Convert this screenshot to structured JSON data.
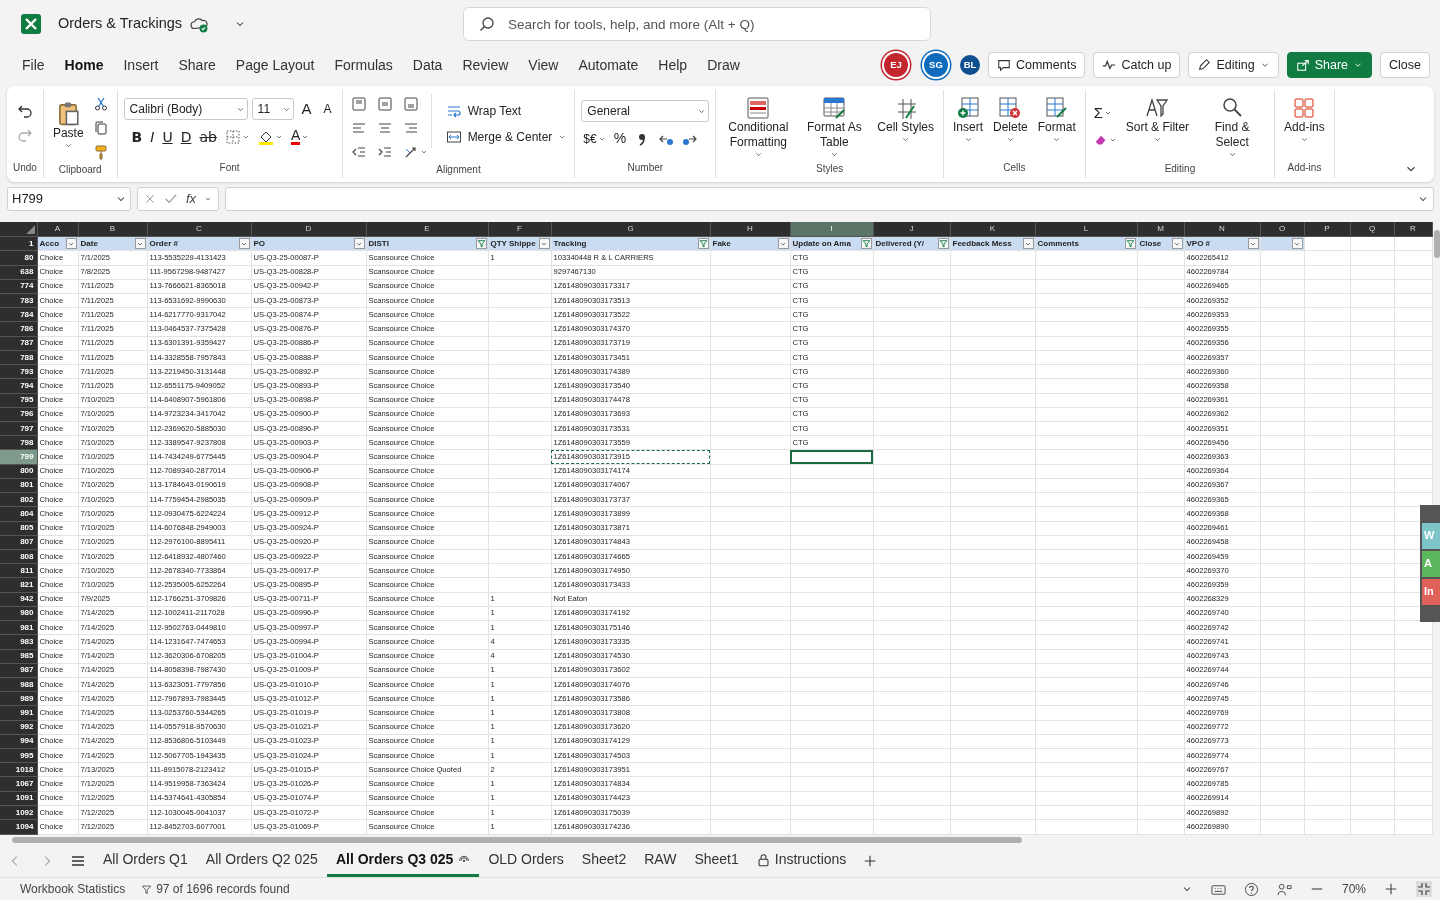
{
  "title_bar": {
    "file_name": "Orders & Trackings",
    "search": {
      "placeholder": "Search for tools, help, and more (Alt + Q)"
    }
  },
  "menu": [
    {
      "text": "File",
      "selected": false
    },
    {
      "text": "Home",
      "selected": true
    },
    {
      "text": "Insert",
      "selected": false
    },
    {
      "text": "Share",
      "selected": false
    },
    {
      "text": "Page Layout",
      "selected": false
    },
    {
      "text": "Formulas",
      "selected": false
    },
    {
      "text": "Data",
      "selected": false
    },
    {
      "text": "Review",
      "selected": false
    },
    {
      "text": "View",
      "selected": false
    },
    {
      "text": "Automate",
      "selected": false
    },
    {
      "text": "Help",
      "selected": false
    },
    {
      "text": "Draw",
      "selected": false
    }
  ],
  "avatars": [
    {
      "initials": "EJ",
      "color": "#c4262e",
      "ring": true
    },
    {
      "initials": "SG",
      "color": "#0f6cbd",
      "ring": true
    },
    {
      "initials": "BL",
      "color": "#0e4f8f",
      "ring": false
    }
  ],
  "actions": [
    {
      "text": "Comments",
      "kind": "comments"
    },
    {
      "text": "Catch up",
      "kind": "catchup"
    },
    {
      "text": "Editing",
      "kind": "editing"
    },
    {
      "text": "Share",
      "kind": "share"
    },
    {
      "text": "Close",
      "kind": "close"
    }
  ],
  "ribbon": [
    {
      "kind": "undo",
      "label": "Undo"
    },
    {
      "kind": "clipboard",
      "label": "Clipboard",
      "paste": "Paste"
    },
    {
      "kind": "font",
      "label": "Font",
      "font_name": "Calibri (Body)",
      "font_size": "11",
      "size_buttons": [
        {
          "text": "A",
          "kind": "grow"
        },
        {
          "text": "A",
          "kind": "shrink"
        }
      ],
      "style_buttons": [
        {
          "text": "B",
          "kind": "bold"
        },
        {
          "text": "I",
          "kind": "italic"
        },
        {
          "text": "U",
          "kind": "underline"
        },
        {
          "text": "D",
          "kind": "double"
        },
        {
          "text": "ab",
          "kind": "strike"
        }
      ],
      "font_color": "A"
    },
    {
      "kind": "alignment",
      "label": "Alignment",
      "wrap": "Wrap Text",
      "merge": "Merge & Center"
    },
    {
      "kind": "number",
      "label": "Number",
      "format": "General",
      "currency": "$€",
      "percent": "%"
    },
    {
      "kind": "styles",
      "label": "Styles",
      "buttons": [
        {
          "text": "Conditional Formatting"
        },
        {
          "text": "Format As Table"
        },
        {
          "text": "Cell Styles"
        }
      ]
    },
    {
      "kind": "cells",
      "label": "Cells",
      "buttons": [
        {
          "text": "Insert"
        },
        {
          "text": "Delete"
        },
        {
          "text": "Format"
        }
      ]
    },
    {
      "kind": "editing",
      "label": "Editing",
      "sum": "Σ",
      "buttons": [
        {
          "text": "Sort & Filter"
        },
        {
          "text": "Find & Select"
        }
      ]
    },
    {
      "kind": "addins",
      "label": "Add-ins",
      "buttons": [
        {
          "text": "Add-ins"
        }
      ]
    }
  ],
  "formula_bar": {
    "name_box": "H799",
    "function_label": "fx"
  },
  "sheet": {
    "header_row": "1",
    "columns": [
      {
        "letter": "A",
        "header": "Acco",
        "filter_active": false,
        "selected": false,
        "marquee": false
      },
      {
        "letter": "B",
        "header": "Date",
        "filter_active": false,
        "selected": false,
        "marquee": false
      },
      {
        "letter": "C",
        "header": "Order #",
        "filter_active": false,
        "selected": false,
        "marquee": false
      },
      {
        "letter": "D",
        "header": "PO",
        "filter_active": false,
        "selected": false,
        "marquee": false
      },
      {
        "letter": "E",
        "header": "DISTI",
        "filter_active": true,
        "selected": false,
        "marquee": false
      },
      {
        "letter": "F",
        "header": "QTY Shippe",
        "filter_active": false,
        "selected": false,
        "marquee": false
      },
      {
        "letter": "G",
        "header": "Tracking",
        "filter_active": true,
        "selected": false,
        "marquee": true
      },
      {
        "letter": "H",
        "header": "Fake",
        "filter_active": false,
        "selected": false,
        "marquee": false
      },
      {
        "letter": "I",
        "header": "Update on Ama",
        "filter_active": true,
        "selected": true,
        "marquee": false
      },
      {
        "letter": "J",
        "header": "Delivered (Y/",
        "filter_active": true,
        "selected": false,
        "marquee": false
      },
      {
        "letter": "K",
        "header": "Feedback Mess",
        "filter_active": false,
        "selected": false,
        "marquee": false
      },
      {
        "letter": "L",
        "header": "Comments",
        "filter_active": true,
        "selected": false,
        "marquee": false
      },
      {
        "letter": "M",
        "header": "Close",
        "filter_active": false,
        "selected": false,
        "marquee": false
      },
      {
        "letter": "N",
        "header": "VPO #",
        "filter_active": false,
        "selected": false,
        "marquee": false
      },
      {
        "letter": "O",
        "filter_active": false,
        "selected": false,
        "marquee": false
      },
      {
        "letter": "P",
        "selected": false,
        "marquee": false
      },
      {
        "letter": "Q",
        "selected": false,
        "marquee": false
      },
      {
        "letter": "R",
        "selected": false,
        "marquee": false
      }
    ],
    "rows": [
      {
        "row": "80",
        "selected": false,
        "A": "Choice",
        "B": "7/1/2025",
        "C": "113-5535229-4131423",
        "D": "US-Q3-25-00087-P",
        "E": "Scansource Choice",
        "F": "1",
        "G": "103340448 R & L CARRIERS",
        "I": "CTG",
        "N": "4602265412"
      },
      {
        "row": "638",
        "selected": false,
        "A": "Choice",
        "B": "7/8/2025",
        "C": "111-9567298-9487427",
        "D": "US-Q3-25-00828-P",
        "E": "Scansource Choice",
        "G": "9297467130",
        "I": "CTG",
        "N": "4602269784"
      },
      {
        "row": "774",
        "selected": false,
        "A": "Choice",
        "B": "7/11/2025",
        "C": "113-7666621-8365018",
        "D": "US-Q3-25-00942-P",
        "E": "Scansource Choice",
        "G": "1Z6148090303173317",
        "I": "CTG",
        "N": "4602269465"
      },
      {
        "row": "783",
        "selected": false,
        "A": "Choice",
        "B": "7/11/2025",
        "C": "113-6531692-9990630",
        "D": "US-Q3-25-00873-P",
        "E": "Scansource Choice",
        "G": "1Z6148090303173513",
        "I": "CTG",
        "N": "4602269352"
      },
      {
        "row": "784",
        "selected": false,
        "A": "Choice",
        "B": "7/11/2025",
        "C": "114-6217770-9317042",
        "D": "US-Q3-25-00874-P",
        "E": "Scansource Choice",
        "G": "1Z6148090303173522",
        "I": "CTG",
        "N": "4602269353"
      },
      {
        "row": "786",
        "selected": false,
        "A": "Choice",
        "B": "7/11/2025",
        "C": "113-0464537-7375428",
        "D": "US-Q3-25-00876-P",
        "E": "Scansource Choice",
        "G": "1Z6148090303174370",
        "I": "CTG",
        "N": "4602269355"
      },
      {
        "row": "787",
        "selected": false,
        "A": "Choice",
        "B": "7/11/2025",
        "C": "113-6301391-9359427",
        "D": "US-Q3-25-00886-P",
        "E": "Scansource Choice",
        "G": "1Z6148090303173719",
        "I": "CTG",
        "N": "4602269356"
      },
      {
        "row": "788",
        "selected": false,
        "A": "Choice",
        "B": "7/11/2025",
        "C": "114-3328558-7957843",
        "D": "US-Q3-25-00888-P",
        "E": "Scansource Choice",
        "G": "1Z6148090303173451",
        "I": "CTG",
        "N": "4602269357"
      },
      {
        "row": "793",
        "selected": false,
        "A": "Choice",
        "B": "7/11/2025",
        "C": "113-2219450-3131448",
        "D": "US-Q3-25-00892-P",
        "E": "Scansource Choice",
        "G": "1Z6148090303174389",
        "I": "CTG",
        "N": "4602269360"
      },
      {
        "row": "794",
        "selected": false,
        "A": "Choice",
        "B": "7/11/2025",
        "C": "112-6551175-9409052",
        "D": "US-Q3-25-00893-P",
        "E": "Scansource Choice",
        "G": "1Z6148090303173540",
        "I": "CTG",
        "N": "4602269358"
      },
      {
        "row": "795",
        "selected": false,
        "A": "Choice",
        "B": "7/10/2025",
        "C": "114-6408907-5961806",
        "D": "US-Q3-25-00898-P",
        "E": "Scansource Choice",
        "G": "1Z6148090303174478",
        "I": "CTG",
        "N": "4602269361"
      },
      {
        "row": "796",
        "selected": false,
        "A": "Choice",
        "B": "7/10/2025",
        "C": "114-9723234-3417042",
        "D": "US-Q3-25-00900-P",
        "E": "Scansource Choice",
        "G": "1Z6148090303173693",
        "I": "CTG",
        "N": "4602269362"
      },
      {
        "row": "797",
        "selected": false,
        "A": "Choice",
        "B": "7/10/2025",
        "C": "112-2369620-5885030",
        "D": "US-Q3-25-00896-P",
        "E": "Scansource Choice",
        "G": "1Z6148090303173531",
        "I": "CTG",
        "N": "4602269351"
      },
      {
        "row": "798",
        "selected": false,
        "A": "Choice",
        "B": "7/10/2025",
        "C": "112-3389547-9237808",
        "D": "US-Q3-25-00903-P",
        "E": "Scansource Choice",
        "G": "1Z6148090303173559",
        "I": "CTG",
        "N": "4602269456"
      },
      {
        "row": "799",
        "selected": true,
        "A": "Choice",
        "B": "7/10/2025",
        "C": "114-7434249-6775445",
        "D": "US-Q3-25-00904-P",
        "E": "Scansource Choice",
        "G": "1Z6148090303173915",
        "N": "4602269363"
      },
      {
        "row": "800",
        "selected": false,
        "A": "Choice",
        "B": "7/10/2025",
        "C": "112-7089340-2877014",
        "D": "US-Q3-25-00906-P",
        "E": "Scansource Choice",
        "G": "1Z6148090303174174",
        "N": "4602269364"
      },
      {
        "row": "801",
        "selected": false,
        "A": "Choice",
        "B": "7/10/2025",
        "C": "113-1784643-0190619",
        "D": "US-Q3-25-00908-P",
        "E": "Scansource Choice",
        "G": "1Z6148090303174067",
        "N": "4602269367"
      },
      {
        "row": "802",
        "selected": false,
        "A": "Choice",
        "B": "7/10/2025",
        "C": "114-7759454-2985035",
        "D": "US-Q3-25-00909-P",
        "E": "Scansource Choice",
        "G": "1Z6148090303173737",
        "N": "4602269365"
      },
      {
        "row": "804",
        "selected": false,
        "A": "Choice",
        "B": "7/10/2025",
        "C": "112-0930475-6224224",
        "D": "US-Q3-25-00912-P",
        "E": "Scansource Choice",
        "G": "1Z6148090303173899",
        "N": "4602269368"
      },
      {
        "row": "805",
        "selected": false,
        "A": "Choice",
        "B": "7/10/2025",
        "C": "114-6076848-2949003",
        "D": "US-Q3-25-00924-P",
        "E": "Scansource Choice",
        "G": "1Z6148090303173871",
        "N": "4602269461"
      },
      {
        "row": "807",
        "selected": false,
        "A": "Choice",
        "B": "7/10/2025",
        "C": "112-2976100-8895411",
        "D": "US-Q3-25-00920-P",
        "E": "Scansource Choice",
        "G": "1Z6148090303174843",
        "N": "4602269458"
      },
      {
        "row": "808",
        "selected": false,
        "A": "Choice",
        "B": "7/10/2025",
        "C": "112-6418932-4807460",
        "D": "US-Q3-25-00922-P",
        "E": "Scansource Choice",
        "G": "1Z6148090303174665",
        "N": "4602269459"
      },
      {
        "row": "811",
        "selected": false,
        "A": "Choice",
        "B": "7/10/2025",
        "C": "112-2678340-7733864",
        "D": "US-Q3-25-00917-P",
        "E": "Scansource Choice",
        "G": "1Z6148090303174950",
        "N": "4602269370"
      },
      {
        "row": "821",
        "selected": false,
        "A": "Choice",
        "B": "7/10/2025",
        "C": "112-2535005-6252264",
        "D": "US-Q3-25-00895-P",
        "E": "Scansource Choice",
        "G": "1Z6148090303173433",
        "N": "4602269359"
      },
      {
        "row": "942",
        "selected": false,
        "A": "Choice",
        "B": "7/9/2025",
        "C": "112-1766251-3709826",
        "D": "US-Q3-25-00711-P",
        "E": "Scansource Choice",
        "F": "1",
        "G": "Not Eaton",
        "N": "4602268329"
      },
      {
        "row": "980",
        "selected": false,
        "A": "Choice",
        "B": "7/14/2025",
        "C": "112-1002411-2117028",
        "D": "US-Q3-25-00996-P",
        "E": "Scansource Choice",
        "F": "1",
        "G": "1Z6148090303174192",
        "N": "4602269740"
      },
      {
        "row": "981",
        "selected": false,
        "A": "Choice",
        "B": "7/14/2025",
        "C": "112-9502763-0449810",
        "D": "US-Q3-25-00997-P",
        "E": "Scansource Choice",
        "F": "1",
        "G": "1Z6148090303175146",
        "N": "4602269742"
      },
      {
        "row": "983",
        "selected": false,
        "A": "Choice",
        "B": "7/14/2025",
        "C": "114-1231647-7474653",
        "D": "US-Q3-25-00994-P",
        "E": "Scansource Choice",
        "F": "4",
        "G": "1Z6148090303173335",
        "N": "4602269741"
      },
      {
        "row": "985",
        "selected": false,
        "A": "Choice",
        "B": "7/14/2025",
        "C": "112-3620306-6708205",
        "D": "US-Q3-25-01004-P",
        "E": "Scansource Choice",
        "F": "4",
        "G": "1Z6148090303174530",
        "N": "4602269743"
      },
      {
        "row": "987",
        "selected": false,
        "A": "Choice",
        "B": "7/14/2025",
        "C": "114-8058398-7987430",
        "D": "US-Q3-25-01009-P",
        "E": "Scansource Choice",
        "F": "1",
        "G": "1Z6148090303173602",
        "N": "4602269744"
      },
      {
        "row": "988",
        "selected": false,
        "A": "Choice",
        "B": "7/14/2025",
        "C": "113-6323051-7797856",
        "D": "US-Q3-25-01010-P",
        "E": "Scansource Choice",
        "F": "1",
        "G": "1Z6148090303174076",
        "N": "4602269746"
      },
      {
        "row": "989",
        "selected": false,
        "A": "Choice",
        "B": "7/14/2025",
        "C": "112-7967893-7983445",
        "D": "US-Q3-25-01012-P",
        "E": "Scansource Choice",
        "F": "1",
        "G": "1Z6148090303173586",
        "N": "4602269745"
      },
      {
        "row": "991",
        "selected": false,
        "A": "Choice",
        "B": "7/14/2025",
        "C": "113-0253760-5344265",
        "D": "US-Q3-25-01019-P",
        "E": "Scansource Choice",
        "F": "1",
        "G": "1Z6148090303173808",
        "N": "4602269769"
      },
      {
        "row": "992",
        "selected": false,
        "A": "Choice",
        "B": "7/14/2025",
        "C": "114-0557918-9570630",
        "D": "US-Q3-25-01021-P",
        "E": "Scansource Choice",
        "F": "1",
        "G": "1Z6148090303173620",
        "N": "4602269772"
      },
      {
        "row": "994",
        "selected": false,
        "A": "Choice",
        "B": "7/14/2025",
        "C": "112-8536806-5103449",
        "D": "US-Q3-25-01023-P",
        "E": "Scansource Choice",
        "F": "1",
        "G": "1Z6148090303174129",
        "N": "4602269773"
      },
      {
        "row": "995",
        "selected": false,
        "A": "Choice",
        "B": "7/14/2025",
        "C": "112-5067705-1943435",
        "D": "US-Q3-25-01024-P",
        "E": "Scansource Choice",
        "F": "1",
        "G": "1Z6148090303174503",
        "N": "4602269774"
      },
      {
        "row": "1018",
        "selected": false,
        "A": "Choice",
        "B": "7/13/2025",
        "C": "111-8915078-2123412",
        "D": "US-Q3-25-01015-P",
        "E": "Scansource Choice Quoted",
        "F": "2",
        "G": "1Z6148090303173951",
        "N": "4602269767"
      },
      {
        "row": "1067",
        "selected": false,
        "A": "Choice",
        "B": "7/12/2025",
        "C": "114-9519958-7363424",
        "D": "US-Q3-25-01026-P",
        "E": "Scansource Choice",
        "F": "1",
        "G": "1Z6148090303174834",
        "N": "4602269785"
      },
      {
        "row": "1091",
        "selected": false,
        "A": "Choice",
        "B": "7/12/2025",
        "C": "114-5374641-4305854",
        "D": "US-Q3-25-01074-P",
        "E": "Scansource Choice",
        "F": "1",
        "G": "1Z6148090303174423",
        "N": "4602269914"
      },
      {
        "row": "1092",
        "selected": false,
        "A": "Choice",
        "B": "7/12/2025",
        "C": "112-1030045-0041037",
        "D": "US-Q3-25-01072-P",
        "E": "Scansource Choice",
        "F": "1",
        "G": "1Z6148090303175039",
        "N": "4602269892"
      },
      {
        "row": "1094",
        "selected": false,
        "A": "Choice",
        "B": "7/12/2025",
        "C": "112-8452703-6077001",
        "D": "US-Q3-25-01069-P",
        "E": "Scansource Choice",
        "F": "1",
        "G": "1Z6148090303174236",
        "N": "4602269890"
      }
    ]
  },
  "side_panel": [
    {
      "text": "W",
      "color": "#7cc4c8"
    },
    {
      "text": "A",
      "color": "#5cb85c"
    },
    {
      "text": "In",
      "color": "#e0605a"
    }
  ],
  "sheet_tabs": [
    {
      "text": "All Orders Q1",
      "selected": false,
      "kind": "plain"
    },
    {
      "text": "All Orders Q2 025",
      "selected": false,
      "kind": "plain"
    },
    {
      "text": "All Orders Q3 025",
      "selected": true,
      "kind": "shared"
    },
    {
      "text": "OLD Orders",
      "selected": false,
      "kind": "plain"
    },
    {
      "text": "Sheet2",
      "selected": false,
      "kind": "plain"
    },
    {
      "text": "RAW",
      "selected": false,
      "kind": "plain"
    },
    {
      "text": "Sheet1",
      "selected": false,
      "kind": "plain"
    },
    {
      "text": "Instructions",
      "selected": false,
      "kind": "locked"
    }
  ],
  "status_bar": {
    "statistics": "Workbook Statistics",
    "records": "97 of 1696 records found",
    "zoom": "70%"
  }
}
